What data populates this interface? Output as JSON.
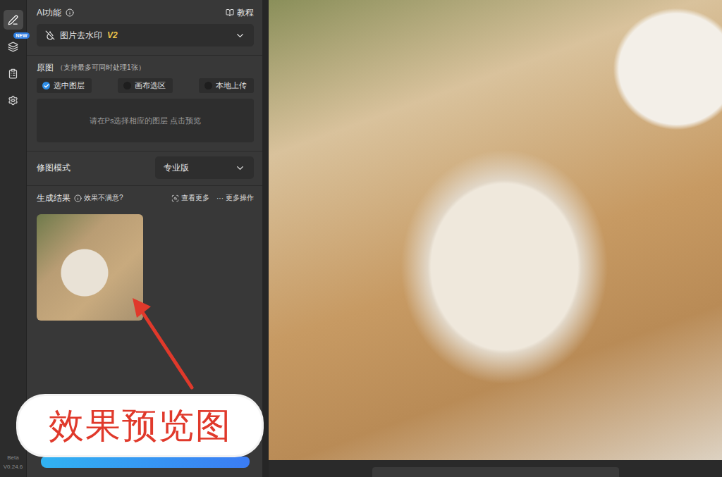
{
  "sidebar": {
    "items": [
      {
        "selected": true,
        "badge": ""
      },
      {
        "selected": false,
        "badge": "NEW"
      },
      {
        "selected": false,
        "badge": ""
      },
      {
        "selected": false,
        "badge": ""
      }
    ],
    "version": {
      "label": "Beta",
      "number": "V0.24.6"
    }
  },
  "header": {
    "title": "AI功能",
    "tutorial": "教程"
  },
  "feature_select": {
    "value": "图片去水印",
    "version": "V2"
  },
  "source": {
    "title": "原图",
    "hint": "（支持最多可同时处理1张）",
    "options": [
      {
        "label": "选中图层",
        "selected": true
      },
      {
        "label": "画布选区",
        "selected": false
      },
      {
        "label": "本地上传",
        "selected": false
      }
    ],
    "placeholder": "请在Ps选择相应的图层 点击预览"
  },
  "mode": {
    "label": "修图模式",
    "value": "专业版"
  },
  "results": {
    "title": "生成结果",
    "feedback": "效果不满意?",
    "view_more": "查看更多",
    "more_icon": "···",
    "more_actions": "更多操作"
  },
  "annotation": {
    "text": "效果预览图"
  }
}
